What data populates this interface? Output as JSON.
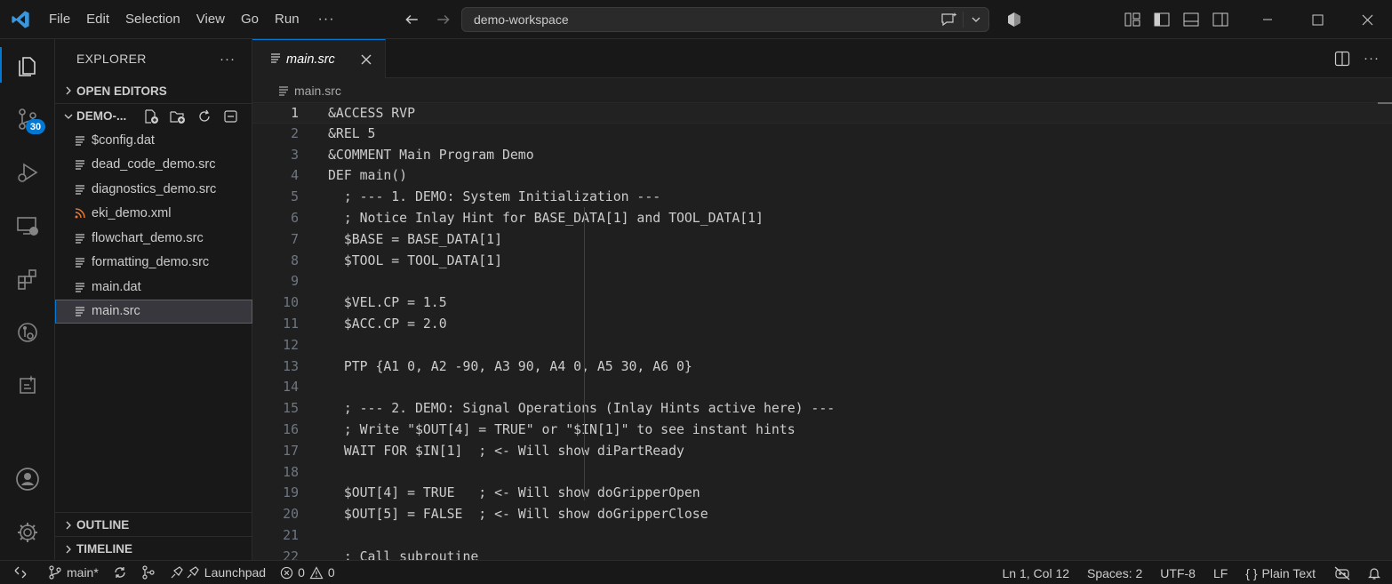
{
  "titlebar": {
    "menu": [
      "File",
      "Edit",
      "Selection",
      "View",
      "Go",
      "Run"
    ],
    "menu_more": "···",
    "search_text": "demo-workspace"
  },
  "activity": {
    "scm_badge": "30"
  },
  "sidebar": {
    "title": "EXPLORER",
    "more": "···",
    "open_editors": "OPEN EDITORS",
    "workspace": "DEMO-...",
    "files": [
      {
        "name": "$config.dat",
        "icon": "lines-file-icon"
      },
      {
        "name": "dead_code_demo.src",
        "icon": "lines-file-icon"
      },
      {
        "name": "diagnostics_demo.src",
        "icon": "lines-file-icon"
      },
      {
        "name": "eki_demo.xml",
        "icon": "rss-file-icon"
      },
      {
        "name": "flowchart_demo.src",
        "icon": "lines-file-icon"
      },
      {
        "name": "formatting_demo.src",
        "icon": "lines-file-icon"
      },
      {
        "name": "main.dat",
        "icon": "lines-file-icon"
      },
      {
        "name": "main.src",
        "icon": "lines-file-icon"
      }
    ],
    "outline": "OUTLINE",
    "timeline": "TIMELINE"
  },
  "editor": {
    "tab_label": "main.src",
    "breadcrumb": "main.src",
    "more": "···",
    "lines": [
      {
        "n": "1",
        "text": "&ACCESS RVP"
      },
      {
        "n": "2",
        "text": "&REL 5"
      },
      {
        "n": "3",
        "text": "&COMMENT Main Program Demo"
      },
      {
        "n": "4",
        "text": "DEF main()"
      },
      {
        "n": "5",
        "text": "  ; --- 1. DEMO: System Initialization ---"
      },
      {
        "n": "6",
        "text": "  ; Notice Inlay Hint for BASE_DATA[1] and TOOL_DATA[1]"
      },
      {
        "n": "7",
        "text": "  $BASE = BASE_DATA[1]"
      },
      {
        "n": "8",
        "text": "  $TOOL = TOOL_DATA[1]"
      },
      {
        "n": "9",
        "text": ""
      },
      {
        "n": "10",
        "text": "  $VEL.CP = 1.5"
      },
      {
        "n": "11",
        "text": "  $ACC.CP = 2.0"
      },
      {
        "n": "12",
        "text": ""
      },
      {
        "n": "13",
        "text": "  PTP {A1 0, A2 -90, A3 90, A4 0, A5 30, A6 0}"
      },
      {
        "n": "14",
        "text": ""
      },
      {
        "n": "15",
        "text": "  ; --- 2. DEMO: Signal Operations (Inlay Hints active here) ---"
      },
      {
        "n": "16",
        "text": "  ; Write \"$OUT[4] = TRUE\" or \"$IN[1]\" to see instant hints"
      },
      {
        "n": "17",
        "text": "  WAIT FOR $IN[1]  ; <- Will show diPartReady"
      },
      {
        "n": "18",
        "text": ""
      },
      {
        "n": "19",
        "text": "  $OUT[4] = TRUE   ; <- Will show doGripperOpen"
      },
      {
        "n": "20",
        "text": "  $OUT[5] = FALSE  ; <- Will show doGripperClose"
      },
      {
        "n": "21",
        "text": ""
      },
      {
        "n": "22",
        "text": "  ; Call subroutine"
      }
    ]
  },
  "status": {
    "branch": "main*",
    "launchpad": "Launchpad",
    "errors": "0",
    "warnings": "0",
    "position": "Ln 1, Col 12",
    "spaces": "Spaces: 2",
    "encoding": "UTF-8",
    "eol": "LF",
    "language": "Plain Text",
    "language_braces": "{ }"
  },
  "colors": {
    "accent": "#0078d4",
    "vscode_logo": "#3a96dd",
    "xml_icon": "#e37933"
  }
}
